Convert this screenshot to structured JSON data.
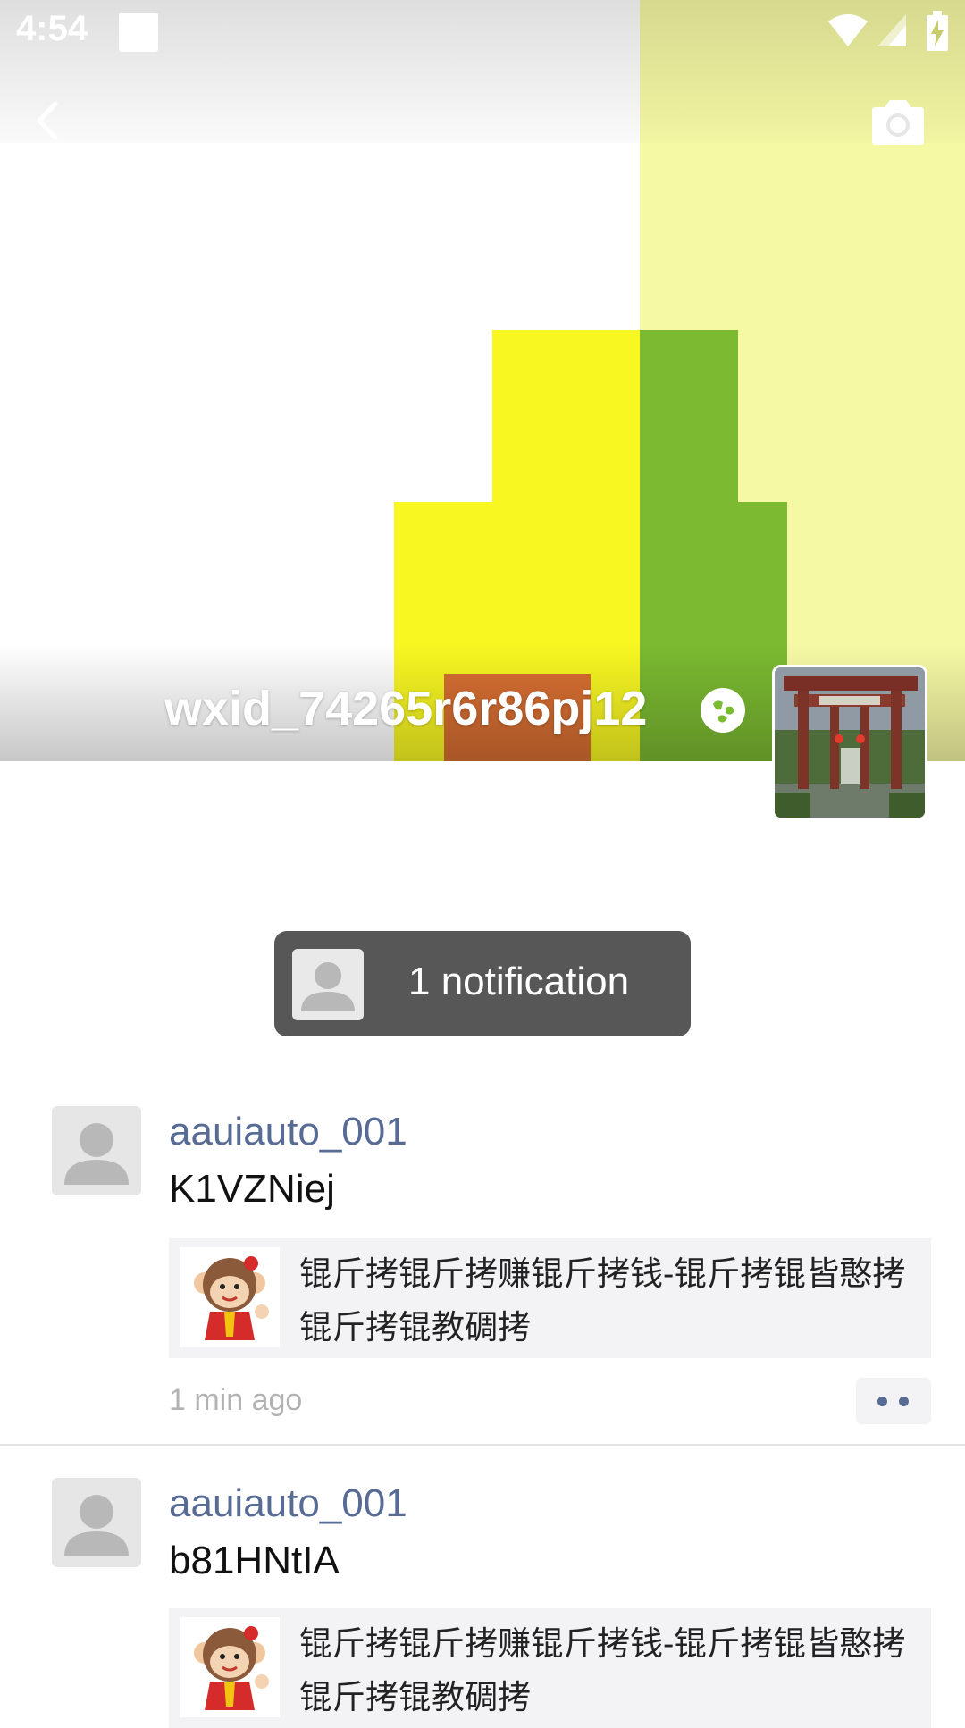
{
  "status_bar": {
    "time": "4:54"
  },
  "profile": {
    "username": "wxid_74265r6r86pj12"
  },
  "notification": {
    "label": "1 notification"
  },
  "feed": [
    {
      "name": "aauiauto_001",
      "text": "K1VZNiej",
      "share_title": "锟斤拷锟斤拷赚锟斤拷钱-锟斤拷锟皆憨拷锟斤拷锟教碉拷",
      "time": "1 min ago"
    },
    {
      "name": "aauiauto_001",
      "text": "b81HNtIA",
      "share_title": "锟斤拷锟斤拷赚锟斤拷钱-锟斤拷锟皆憨拷锟斤拷锟教碉拷"
    }
  ],
  "colors": {
    "link_name": "#576b95",
    "cover_yellow": "#f8f722",
    "cover_green": "#7bba31",
    "cover_orange": "#d86f32",
    "notif_bg": "#575757"
  }
}
